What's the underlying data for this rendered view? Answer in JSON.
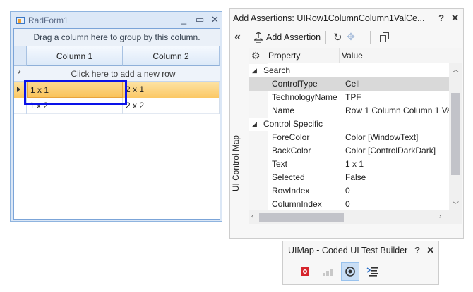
{
  "radform": {
    "title": "RadForm1",
    "buttons": {
      "minimize": "_",
      "maximize": "▭",
      "close": "✕"
    },
    "group_panel_text": "Drag a column here to group by this column.",
    "columns": [
      "Column 1",
      "Column 2"
    ],
    "new_row_text": "Click here to add a new row",
    "rows": [
      {
        "c1": "1 x 1",
        "c2": "2 x 1",
        "selected": true
      },
      {
        "c1": "1 x 2",
        "c2": "2 x 2",
        "selected": false
      }
    ]
  },
  "assertions": {
    "title": "Add Assertions: UIRow1ColumnColumn1ValCe...",
    "pin": "?",
    "close": "✕",
    "toolbar": {
      "collapse": "«",
      "add_assertion_label": "Add Assertion",
      "refresh": "↻",
      "crosshair": "✥",
      "copy_icon": "copy-icon"
    },
    "side_label": "UI Control Map",
    "headers": {
      "property": "Property",
      "value": "Value"
    },
    "categories": [
      {
        "name": "Search",
        "rows": [
          {
            "property": "ControlType",
            "value": "Cell",
            "selected": true
          },
          {
            "property": "TechnologyName",
            "value": "TPF"
          },
          {
            "property": "Name",
            "value": "Row 1 Column Column 1 Va"
          }
        ]
      },
      {
        "name": "Control Specific",
        "rows": [
          {
            "property": "ForeColor",
            "value": "Color [WindowText]"
          },
          {
            "property": "BackColor",
            "value": "Color [ControlDarkDark]"
          },
          {
            "property": "Text",
            "value": "1 x 1"
          },
          {
            "property": "Selected",
            "value": "False"
          },
          {
            "property": "RowIndex",
            "value": "0"
          },
          {
            "property": "ColumnIndex",
            "value": "0"
          }
        ]
      }
    ]
  },
  "builder": {
    "title": "UIMap - Coded UI Test Builder",
    "pin": "?",
    "close": "✕",
    "tools": [
      "record-icon",
      "steps-icon",
      "target-icon",
      "generate-code-icon"
    ]
  },
  "colors": {
    "selection_outline": "#0a12e8",
    "selected_row": "#fbc865",
    "record_red": "#d6252d"
  }
}
